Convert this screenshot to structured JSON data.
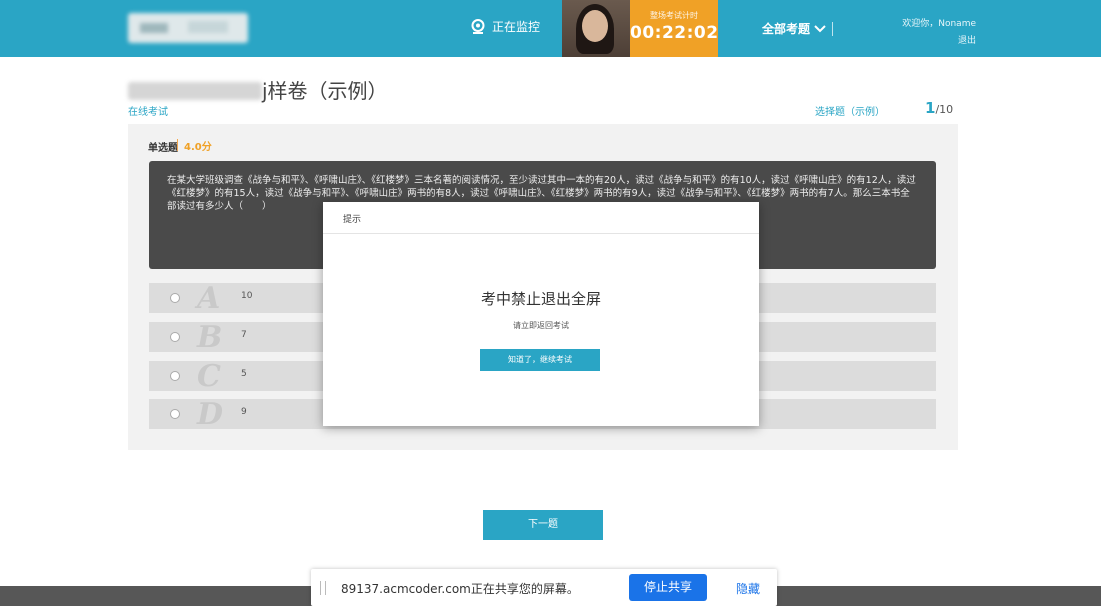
{
  "header": {
    "monitor_status": "正在监控",
    "timer_label": "整场考试计时",
    "timer_value": "00:22:02",
    "all_questions_label": "全部考题",
    "welcome_text": "欢迎你，Noname",
    "logout_label": "退出"
  },
  "page": {
    "title_suffix": "j样卷（示例）",
    "breadcrumb": "在线考试",
    "question_type_info": "选择题（示例）",
    "progress_current": "1",
    "progress_total": "/10"
  },
  "question": {
    "type": "单选题",
    "score": "4.0分",
    "stem": "在某大学班级调查《战争与和平》、《呼啸山庄》、《红楼梦》三本名著的阅读情况，至少读过其中一本的有20人，读过《战争与和平》的有10人，读过《呼啸山庄》的有12人，读过《红楼梦》的有15人，读过《战争与和平》、《呼啸山庄》两书的有8人，读过《呼啸山庄》、《红楼梦》两书的有9人，读过《战争与和平》、《红楼梦》两书的有7人。那么三本书全部读过有多少人（　　）",
    "options": [
      {
        "letter": "A",
        "text": "10"
      },
      {
        "letter": "B",
        "text": "7"
      },
      {
        "letter": "C",
        "text": "5"
      },
      {
        "letter": "D",
        "text": "9"
      }
    ]
  },
  "next_button": "下一题",
  "modal": {
    "title": "提示",
    "message": "考中禁止退出全屏",
    "sub_message": "请立即返回考试",
    "button": "知道了，继续考试"
  },
  "share_bar": {
    "text": "89137.acmcoder.com正在共享您的屏幕。",
    "stop_label": "停止共享",
    "hide_label": "隐藏"
  },
  "colors": {
    "header": "#2aa5c5",
    "timer": "#f0a126",
    "share_button": "#1a73e8"
  }
}
